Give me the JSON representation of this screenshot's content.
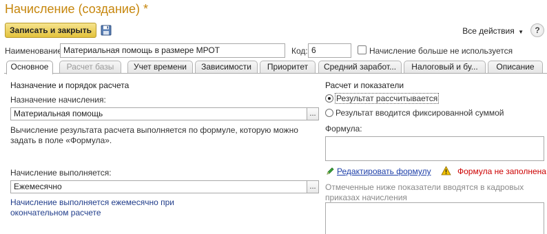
{
  "window": {
    "title": "Начисление (создание) *"
  },
  "toolbar": {
    "save_close_label": "Записать и закрыть",
    "all_actions_label": "Все действия",
    "help_label": "?"
  },
  "header_fields": {
    "name_label": "Наименование:",
    "name_value": "Материальная помощь в размере МРОТ",
    "code_label": "Код:",
    "code_value": "6",
    "unused_checkbox_label": "Начисление больше не используется",
    "unused_checked": false
  },
  "tabs": [
    {
      "label": "Основное",
      "active": true,
      "disabled": false
    },
    {
      "label": "Расчет базы",
      "active": false,
      "disabled": true
    },
    {
      "label": "Учет времени",
      "active": false,
      "disabled": false
    },
    {
      "label": "Зависимости",
      "active": false,
      "disabled": false
    },
    {
      "label": "Приоритет",
      "active": false,
      "disabled": false
    },
    {
      "label": "Средний заработ...",
      "active": false,
      "disabled": false
    },
    {
      "label": "Налоговый и бу...",
      "active": false,
      "disabled": false
    },
    {
      "label": "Описание",
      "active": false,
      "disabled": false
    }
  ],
  "left": {
    "section_title": "Назначение и порядок расчета",
    "purpose_label": "Назначение начисления:",
    "purpose_value": "Материальная помощь",
    "purpose_btn": "...",
    "calc_desc": "Вычисление результата расчета выполняется по формуле, которую можно задать в поле «Формула».",
    "schedule_label": "Начисление выполняется:",
    "schedule_value": "Ежемесячно",
    "schedule_btn": "...",
    "schedule_desc": "Начисление выполняется ежемесячно при окончательном расчете"
  },
  "right": {
    "section_title": "Расчет и показатели",
    "radio_calculated": "Результат рассчитывается",
    "radio_fixed": "Результат вводится фиксированной суммой",
    "selected_radio": "calculated",
    "formula_label": "Формула:",
    "formula_value": "",
    "edit_formula_link": "Редактировать формулу",
    "warning_text": "Формула не заполнена",
    "indicators_hint": "Отмеченные ниже показатели вводятся в кадровых приказах начисления"
  },
  "colors": {
    "title": "#c6860c",
    "primary_button": "#e3c23c",
    "link": "#1c3ea8",
    "warning": "#cc0000",
    "warning_icon": "#f2c200"
  }
}
